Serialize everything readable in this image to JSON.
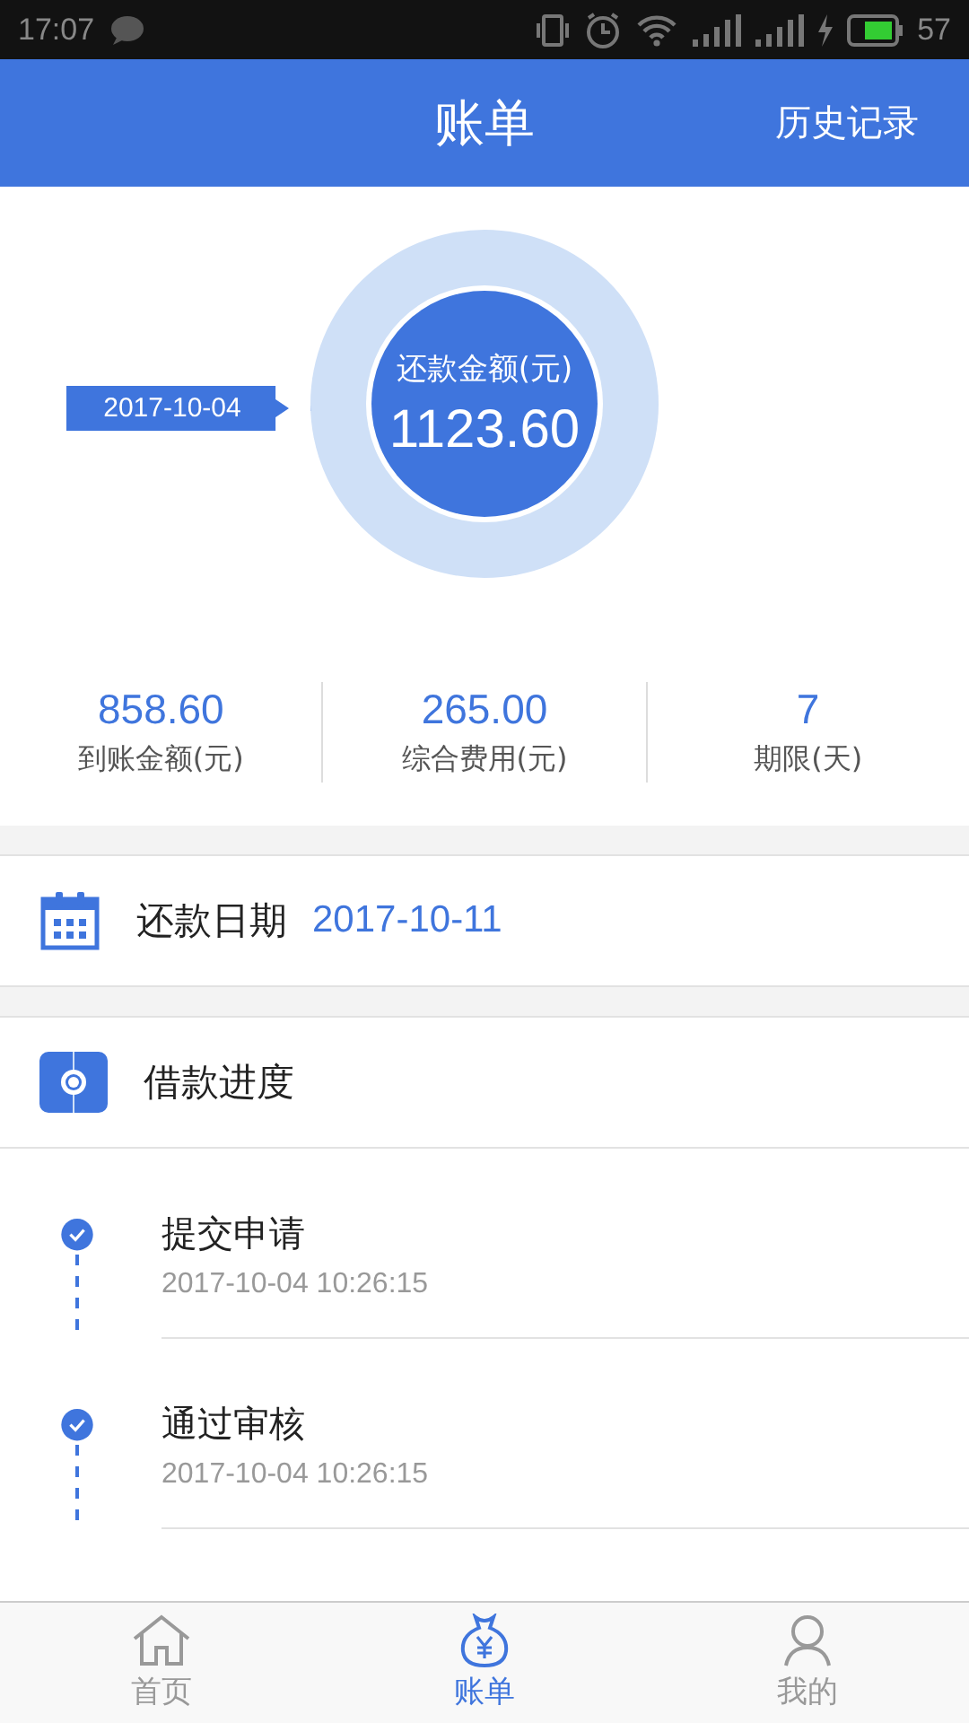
{
  "status_bar": {
    "time": "17:07",
    "battery": "57"
  },
  "header": {
    "title": "账单",
    "action": "历史记录"
  },
  "summary": {
    "date_tag": "2017-10-04",
    "ring_label": "还款金额(元)",
    "amount": "1123.60"
  },
  "stats": [
    {
      "value": "858.60",
      "label": "到账金额(元)"
    },
    {
      "value": "265.00",
      "label": "综合费用(元)"
    },
    {
      "value": "7",
      "label": "期限(天)"
    }
  ],
  "repayment": {
    "label": "还款日期",
    "date": "2017-10-11"
  },
  "progress": {
    "title": "借款进度",
    "steps": [
      {
        "title": "提交申请",
        "time": "2017-10-04 10:26:15",
        "done": true
      },
      {
        "title": "通过审核",
        "time": "2017-10-04 10:26:15",
        "done": true
      }
    ]
  },
  "tabs": [
    {
      "label": "首页",
      "kind": "home",
      "selected": false
    },
    {
      "label": "账单",
      "kind": "bill",
      "selected": true
    },
    {
      "label": "我的",
      "kind": "profile",
      "selected": false
    }
  ]
}
